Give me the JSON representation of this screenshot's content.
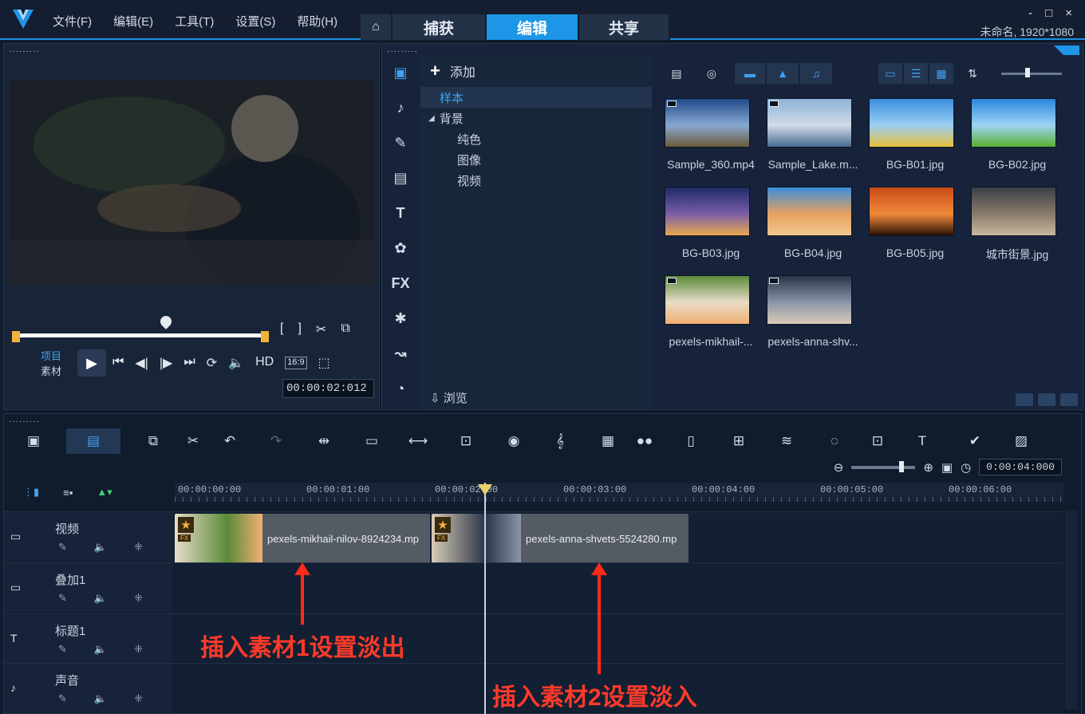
{
  "app": {
    "menu": [
      "文件(F)",
      "编辑(E)",
      "工具(T)",
      "设置(S)",
      "帮助(H)"
    ],
    "tabs": [
      "捕获",
      "编辑",
      "共享"
    ],
    "project_info": "未命名, 1920*1080",
    "window_controls": [
      "-",
      "□",
      "×"
    ]
  },
  "preview": {
    "dots": "·········",
    "mode_project": "项目",
    "mode_clip": "素材",
    "hd_label": "HD",
    "aspect_label": "16:9",
    "timecode": "00:00:02:012",
    "tools": [
      "[",
      "]",
      "✂",
      "⧉"
    ]
  },
  "library": {
    "add_label": "添加",
    "tree": [
      "样本",
      "背景",
      "纯色",
      "图像",
      "视频"
    ],
    "browse_label": "浏览",
    "side_icons": [
      "media-icon",
      "audio-icon",
      "instant-project-icon",
      "template-icon",
      "title-icon",
      "graphic-icon",
      "fx-icon",
      "filter-icon",
      "path-icon",
      "speed-icon"
    ],
    "side_glyphs": [
      "▣",
      "♪",
      "✎",
      "▤",
      "T",
      "✿",
      "FX",
      "✱",
      "↝",
      "◔"
    ],
    "media": [
      {
        "name": "Sample_360.mp4",
        "colors": [
          "#1f4a8a",
          "#88a8d0",
          "#6b5a3a"
        ],
        "badge": true
      },
      {
        "name": "Sample_Lake.m...",
        "colors": [
          "#8eb2d6",
          "#d0dbe6",
          "#4a6a92"
        ],
        "badge": true
      },
      {
        "name": "BG-B01.jpg",
        "colors": [
          "#3a8ee0",
          "#9ccff0",
          "#e6c03a"
        ]
      },
      {
        "name": "BG-B02.jpg",
        "colors": [
          "#2a86e0",
          "#9fd3f2",
          "#58b030"
        ]
      },
      {
        "name": "BG-B03.jpg",
        "colors": [
          "#1d2a66",
          "#7a5ea8",
          "#e8a850"
        ]
      },
      {
        "name": "BG-B04.jpg",
        "colors": [
          "#3a8ed8",
          "#e8a060",
          "#f0c890"
        ]
      },
      {
        "name": "BG-B05.jpg",
        "colors": [
          "#c84a1a",
          "#f08a3a",
          "#2a1208"
        ]
      },
      {
        "name": "城市街景.jpg",
        "colors": [
          "#3a3e48",
          "#8a7a6a",
          "#c8b8a0"
        ]
      },
      {
        "name": "pexels-mikhail-...",
        "colors": [
          "#5a8a3a",
          "#e8dcc8",
          "#f0b070"
        ],
        "badge": true
      },
      {
        "name": "pexels-anna-shv...",
        "colors": [
          "#2a3448",
          "#8a96a8",
          "#d8ccb8"
        ],
        "badge": true
      }
    ]
  },
  "timeline": {
    "current_time": "0:00:04:000",
    "ruler": [
      "00:00:00:00",
      "00:00:01:00",
      "00:00:02:00",
      "00:00:03:00",
      "00:00:04:00",
      "00:00:05:00",
      "00:00:06:00"
    ],
    "tracks": [
      {
        "name": "视频",
        "icon": "video-track-icon",
        "glyph": "▭"
      },
      {
        "name": "叠加1",
        "icon": "overlay-track-icon",
        "glyph": "▭"
      },
      {
        "name": "标题1",
        "icon": "title-track-icon",
        "glyph": "T"
      },
      {
        "name": "声音",
        "icon": "voice-track-icon",
        "glyph": "♪"
      }
    ],
    "clips": [
      {
        "name": "pexels-mikhail-nilov-8924234.mp"
      },
      {
        "name": "pexels-anna-shvets-5524280.mp"
      }
    ]
  },
  "annotations": [
    "插入素材1设置淡出",
    "插入素材2设置淡入"
  ]
}
